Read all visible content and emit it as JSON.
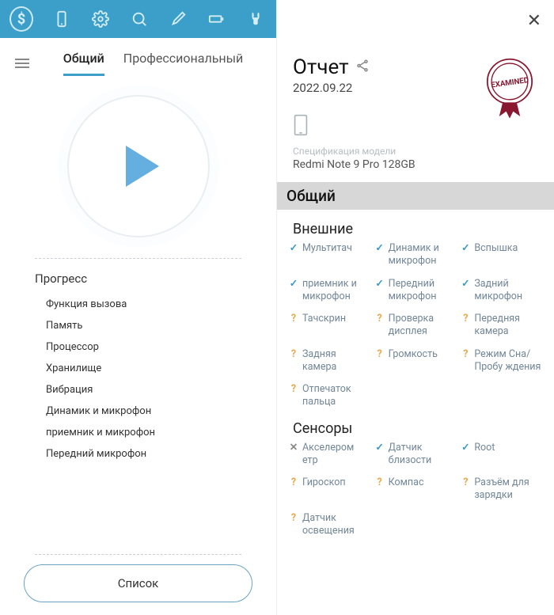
{
  "left": {
    "tabs": {
      "general": "Общий",
      "pro": "Профессиональный"
    },
    "progress_title": "Прогресс",
    "progress_items": [
      "Функция вызова",
      "Память",
      "Процессор",
      "Хранилище",
      "Вибрация",
      "Динамик и микрофон",
      "приемник и микрофон",
      "Передний микрофон"
    ],
    "list_button": "Список"
  },
  "right": {
    "report_title": "Отчет",
    "report_date": "2022.09.22",
    "spec_label": "Спецификация модели",
    "device": "Redmi Note 9 Pro 128GB",
    "stamp_text": "EXAMINED",
    "section_general": "Общий",
    "section_external": "Внешние",
    "section_sensors": "Сенсоры",
    "external": [
      {
        "s": "ok",
        "t": "Мультитач"
      },
      {
        "s": "ok",
        "t": "Динамик и микрофон"
      },
      {
        "s": "ok",
        "t": "Вспышка"
      },
      {
        "s": "ok",
        "t": "приемник и микрофон"
      },
      {
        "s": "ok",
        "t": "Передний микрофон"
      },
      {
        "s": "ok",
        "t": "Задний микрофон"
      },
      {
        "s": "q",
        "t": "Тачскрин"
      },
      {
        "s": "q",
        "t": "Проверка дисплея"
      },
      {
        "s": "q",
        "t": "Передняя камера"
      },
      {
        "s": "q",
        "t": "Задняя камера"
      },
      {
        "s": "q",
        "t": "Громкость"
      },
      {
        "s": "q",
        "t": "Режим Сна/ Пробу ждения"
      },
      {
        "s": "q",
        "t": "Отпечаток пальца"
      }
    ],
    "sensors": [
      {
        "s": "x",
        "t": "Акселером етр"
      },
      {
        "s": "ok",
        "t": "Датчик близости"
      },
      {
        "s": "ok",
        "t": "Root"
      },
      {
        "s": "q",
        "t": "Гироскоп"
      },
      {
        "s": "q",
        "t": "Компас"
      },
      {
        "s": "q",
        "t": "Разъём для зарядки"
      },
      {
        "s": "q",
        "t": "Датчик освещения"
      }
    ]
  }
}
